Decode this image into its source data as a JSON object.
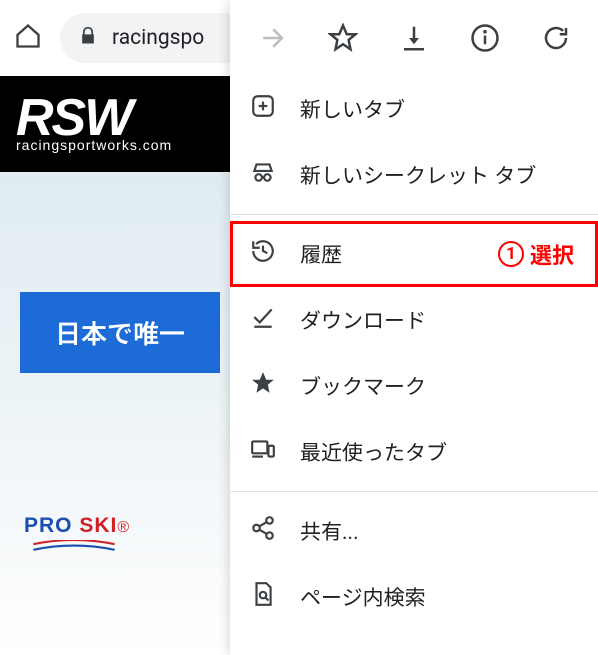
{
  "toolbar": {
    "url_text": "racingspo"
  },
  "page": {
    "logo_main": "RSW",
    "logo_sub": "racingsportworks.com",
    "cta_text": "日本で唯一",
    "proski_pro": "PRO ",
    "proski_ski": "SKI"
  },
  "menu": {
    "items": [
      {
        "key": "new-tab",
        "label": "新しいタブ"
      },
      {
        "key": "incognito",
        "label": "新しいシークレット タブ"
      },
      {
        "key": "history",
        "label": "履歴"
      },
      {
        "key": "downloads",
        "label": "ダウンロード"
      },
      {
        "key": "bookmarks",
        "label": "ブックマーク"
      },
      {
        "key": "recent-tabs",
        "label": "最近使ったタブ"
      },
      {
        "key": "share",
        "label": "共有..."
      },
      {
        "key": "find",
        "label": "ページ内検索"
      }
    ]
  },
  "annotation": {
    "number": "1",
    "text": "選択"
  }
}
